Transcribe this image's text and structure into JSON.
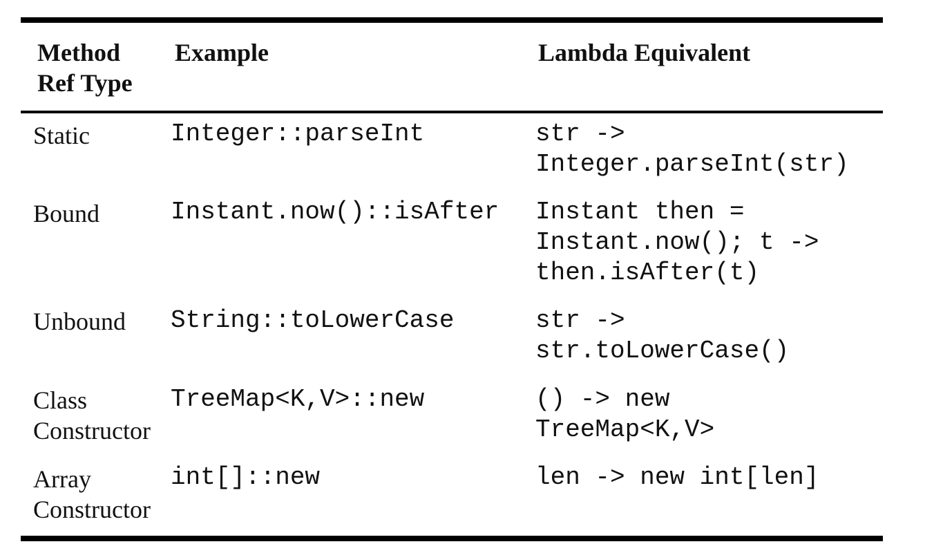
{
  "table": {
    "headers": {
      "type": [
        "Method",
        "Ref Type"
      ],
      "example": "Example",
      "lambda": "Lambda Equivalent"
    },
    "rows": [
      {
        "type": [
          "Static"
        ],
        "example": "Integer::parseInt",
        "lambda": [
          "str ->",
          "Integer.parseInt(str)"
        ]
      },
      {
        "type": [
          "Bound"
        ],
        "example": "Instant.now()::isAfter",
        "lambda": [
          "Instant then =",
          "Instant.now(); t ->",
          "then.isAfter(t)"
        ]
      },
      {
        "type": [
          "Unbound"
        ],
        "example": "String::toLowerCase",
        "lambda": [
          "str ->",
          "str.toLowerCase()"
        ]
      },
      {
        "type": [
          "Class",
          "Constructor"
        ],
        "example": "TreeMap<K,V>::new",
        "lambda": [
          "() -> new",
          "TreeMap<K,V>"
        ]
      },
      {
        "type": [
          "Array",
          "Constructor"
        ],
        "example": "int[]::new",
        "lambda": [
          "len -> new int[len]"
        ]
      }
    ]
  }
}
